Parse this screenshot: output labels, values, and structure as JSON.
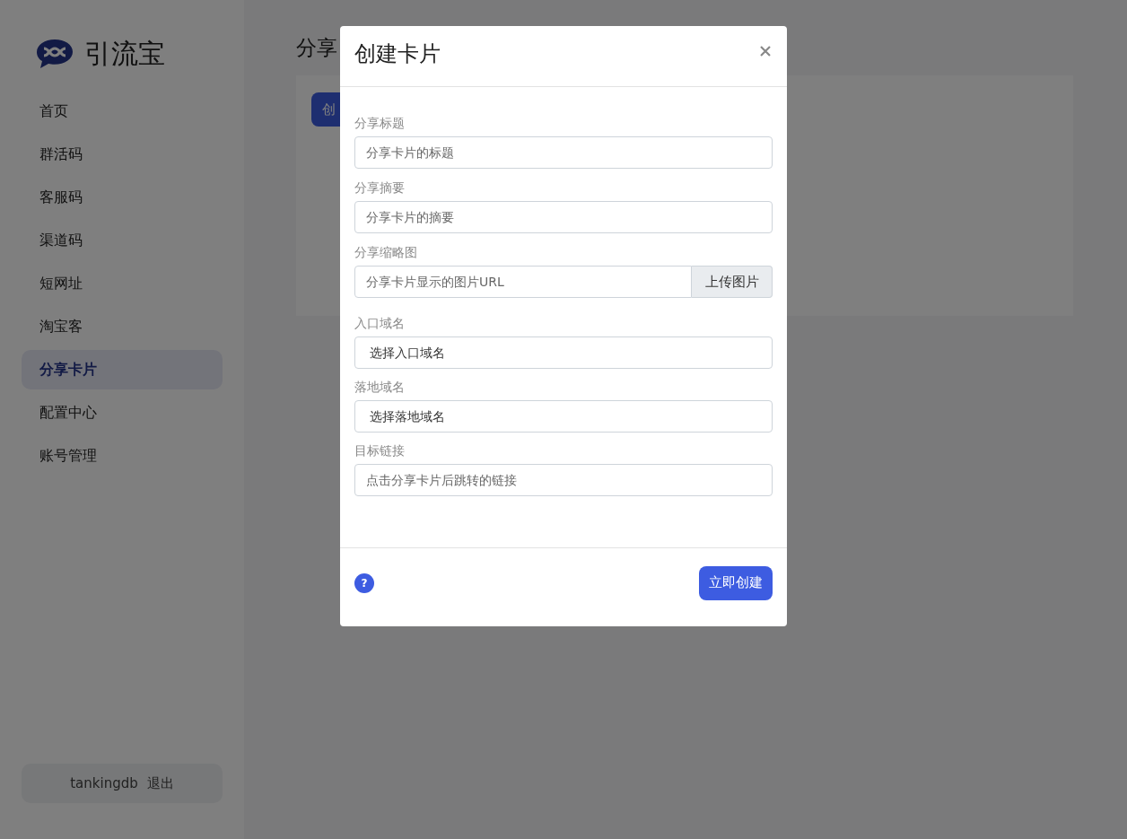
{
  "sidebar": {
    "brand": "引流宝",
    "items": [
      {
        "label": "首页",
        "selected": false
      },
      {
        "label": "群活码",
        "selected": false
      },
      {
        "label": "客服码",
        "selected": false
      },
      {
        "label": "渠道码",
        "selected": false
      },
      {
        "label": "短网址",
        "selected": false
      },
      {
        "label": "淘宝客",
        "selected": false
      },
      {
        "label": "分享卡片",
        "selected": true
      },
      {
        "label": "配置中心",
        "selected": false
      },
      {
        "label": "账号管理",
        "selected": false
      }
    ],
    "user": {
      "name": "tankingdb",
      "logout": "退出"
    }
  },
  "page": {
    "title": "分享",
    "create_button": "创"
  },
  "modal": {
    "title": "创建卡片",
    "fields": [
      {
        "kind": "text",
        "label": "分享标题",
        "placeholder": "分享卡片的标题"
      },
      {
        "kind": "text",
        "label": "分享摘要",
        "placeholder": "分享卡片的摘要"
      },
      {
        "kind": "upload",
        "label": "分享缩略图",
        "placeholder": "分享卡片显示的图片URL",
        "button": "上传图片"
      },
      {
        "kind": "select",
        "label": "入口域名",
        "value": "选择入口域名"
      },
      {
        "kind": "select",
        "label": "落地域名",
        "value": "选择落地域名"
      },
      {
        "kind": "text",
        "label": "目标链接",
        "placeholder": "点击分享卡片后跳转的链接"
      }
    ],
    "help": "?",
    "submit": "立即创建"
  }
}
